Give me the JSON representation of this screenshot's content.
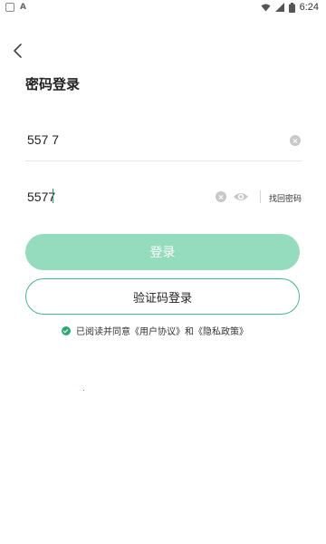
{
  "status_bar": {
    "time": "6:24",
    "left_badge": "A"
  },
  "header": {
    "title": "密码登录"
  },
  "phone": {
    "value": "557 7"
  },
  "password": {
    "value": "5577"
  },
  "forgot_label": "找回密码",
  "login_label": "登录",
  "code_login_label": "验证码登录",
  "agreement": {
    "prefix": "已阅读并同意",
    "user_agreement": "《用户协议》",
    "and": "和",
    "privacy_policy": "《隐私政策》"
  },
  "colors": {
    "accent": "#2eaa73",
    "button_fill": "#94dcbd",
    "outline": "#47b68a"
  }
}
